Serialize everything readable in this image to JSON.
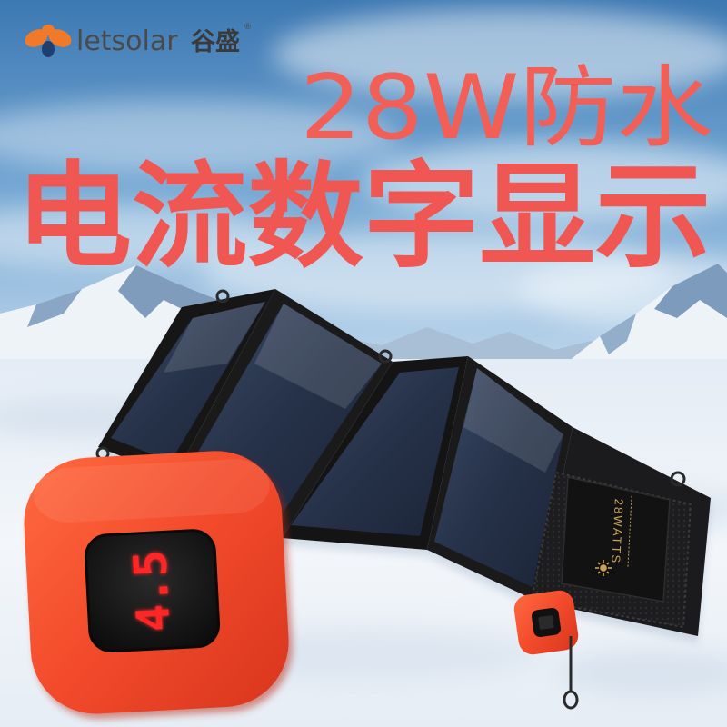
{
  "brand": {
    "name": "letsolar",
    "name_cn": "谷盛",
    "registered": "®"
  },
  "headline": "28W防水",
  "subheadline": "电流数字显示",
  "device": {
    "display_value": "4.5"
  },
  "panel": {
    "pocket_label": "28WATTS"
  },
  "colors": {
    "accent": "#f25f57",
    "device_orange": "#f24a2b",
    "display_red": "#ff2626",
    "panel_cell": "#2a3650",
    "sky": "#5f97c9",
    "snow": "#eef3f8"
  },
  "icons": {
    "logo": "letsolar-logo-icon",
    "pocket": "sun-icon"
  }
}
